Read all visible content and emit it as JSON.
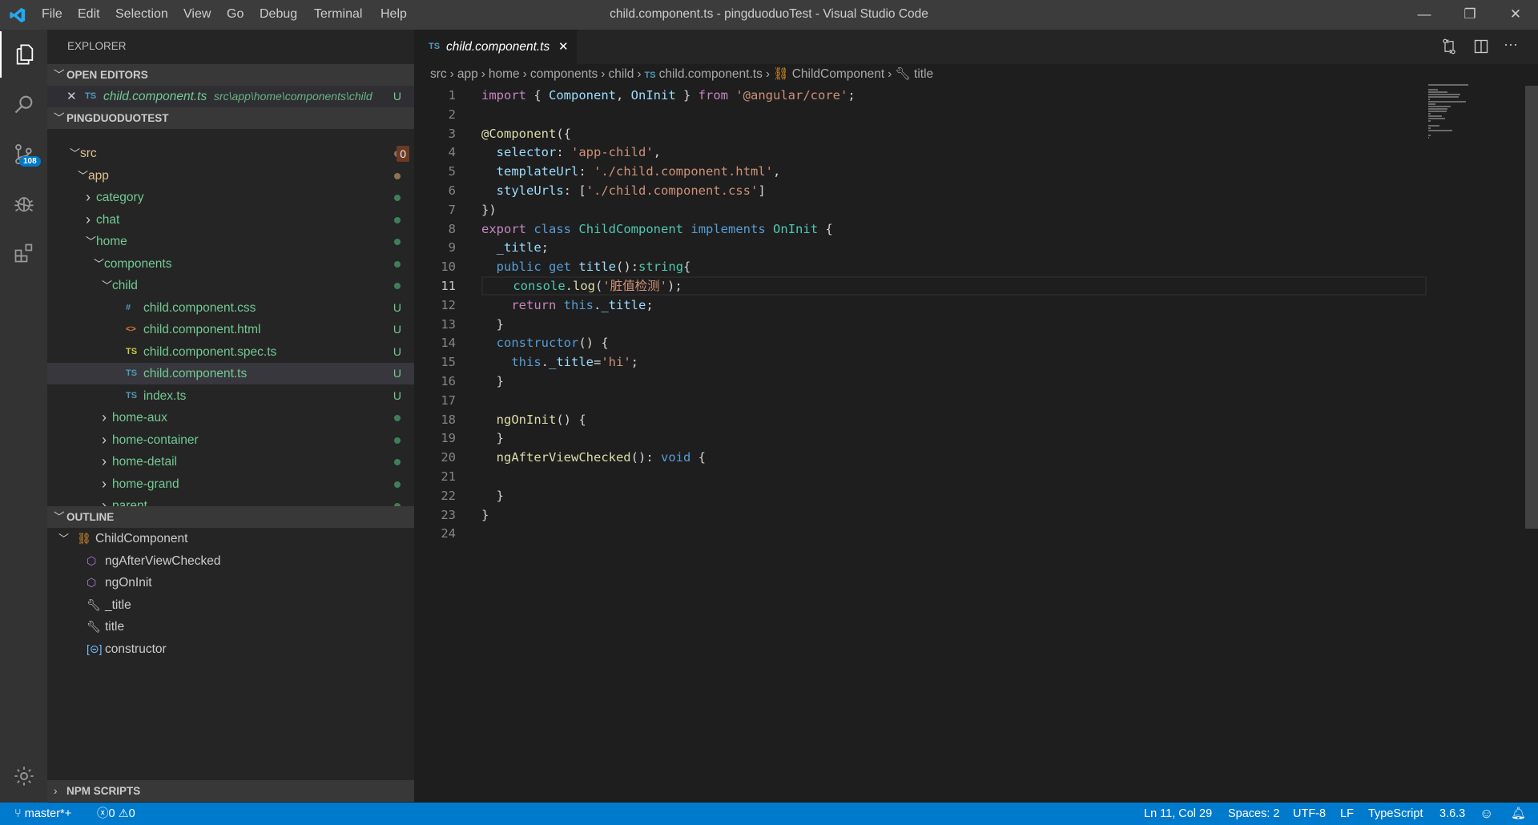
{
  "window": {
    "title": "child.component.ts - pingduoduoTest - Visual Studio Code",
    "menu": [
      "File",
      "Edit",
      "Selection",
      "View",
      "Go",
      "Debug",
      "Terminal",
      "Help"
    ],
    "controls": {
      "minimize": "—",
      "restore": "❐",
      "close": "✕"
    }
  },
  "activity_bar": {
    "items": [
      "explorer-icon",
      "search-icon",
      "source-control-icon",
      "debug-icon",
      "extensions-icon"
    ],
    "scm_badge": "108",
    "settings": "gear-icon"
  },
  "sidebar": {
    "title": "EXPLORER",
    "open_editors": {
      "header": "OPEN EDITORS",
      "items": [
        {
          "icon": "TS",
          "name": "child.component.ts",
          "path": "src\\app\\home\\components\\child",
          "status": "U"
        }
      ]
    },
    "project": {
      "header": "PINGDUODUOTEST",
      "tree": [
        {
          "name": "src",
          "depth": 0,
          "kind": "folder",
          "expanded": true,
          "status": "badge",
          "badge": "0",
          "color": "#e2c08d"
        },
        {
          "name": "app",
          "depth": 1,
          "kind": "folder",
          "expanded": true,
          "status": "dot",
          "color": "#e2c08d",
          "dot": "#8a7356"
        },
        {
          "name": "category",
          "depth": 2,
          "kind": "folder",
          "expanded": false,
          "status": "dot",
          "color": "#73c991"
        },
        {
          "name": "chat",
          "depth": 2,
          "kind": "folder",
          "expanded": false,
          "status": "dot",
          "color": "#73c991"
        },
        {
          "name": "home",
          "depth": 2,
          "kind": "folder",
          "expanded": true,
          "status": "dot",
          "color": "#73c991"
        },
        {
          "name": "components",
          "depth": 3,
          "kind": "folder",
          "expanded": true,
          "status": "dot",
          "color": "#73c991"
        },
        {
          "name": "child",
          "depth": 4,
          "kind": "folder",
          "expanded": true,
          "status": "dot",
          "color": "#73c991"
        },
        {
          "name": "child.component.css",
          "depth": 5,
          "kind": "file",
          "icon": "#",
          "iconColor": "#519aba",
          "status": "U",
          "color": "#73c991"
        },
        {
          "name": "child.component.html",
          "depth": 5,
          "kind": "file",
          "icon": "<>",
          "iconColor": "#e37933",
          "status": "U",
          "color": "#73c991"
        },
        {
          "name": "child.component.spec.ts",
          "depth": 5,
          "kind": "file",
          "icon": "TS",
          "iconColor": "#cbcb41",
          "status": "U",
          "color": "#73c991"
        },
        {
          "name": "child.component.ts",
          "depth": 5,
          "kind": "file",
          "icon": "TS",
          "iconColor": "#519aba",
          "status": "U",
          "color": "#73c991",
          "selected": true
        },
        {
          "name": "index.ts",
          "depth": 5,
          "kind": "file",
          "icon": "TS",
          "iconColor": "#519aba",
          "status": "U",
          "color": "#73c991"
        },
        {
          "name": "home-aux",
          "depth": 4,
          "kind": "folder",
          "expanded": false,
          "status": "dot",
          "color": "#73c991"
        },
        {
          "name": "home-container",
          "depth": 4,
          "kind": "folder",
          "expanded": false,
          "status": "dot",
          "color": "#73c991"
        },
        {
          "name": "home-detail",
          "depth": 4,
          "kind": "folder",
          "expanded": false,
          "status": "dot",
          "color": "#73c991"
        },
        {
          "name": "home-grand",
          "depth": 4,
          "kind": "folder",
          "expanded": false,
          "status": "dot",
          "color": "#73c991"
        },
        {
          "name": "parent",
          "depth": 4,
          "kind": "folder",
          "expanded": false,
          "status": "dot",
          "color": "#73c991"
        }
      ]
    },
    "outline": {
      "header": "OUTLINE",
      "items": [
        {
          "name": "ChildComponent",
          "depth": 0,
          "icon": "class-icon",
          "expanded": true
        },
        {
          "name": "ngAfterViewChecked",
          "depth": 1,
          "icon": "method-icon"
        },
        {
          "name": "ngOnInit",
          "depth": 1,
          "icon": "method-icon"
        },
        {
          "name": "_title",
          "depth": 1,
          "icon": "property-icon"
        },
        {
          "name": "title",
          "depth": 1,
          "icon": "property-icon"
        },
        {
          "name": "constructor",
          "depth": 1,
          "icon": "constructor-icon"
        }
      ]
    },
    "npm_scripts": {
      "header": "NPM SCRIPTS"
    }
  },
  "editor": {
    "tab": {
      "icon": "TS",
      "label": "child.component.ts",
      "close": "✕"
    },
    "breadcrumbs": [
      "src",
      "app",
      "home",
      "components",
      "child",
      "child.component.ts",
      "ChildComponent",
      "title"
    ],
    "current_line": 11,
    "lines": [
      [
        [
          "import",
          "kw"
        ],
        [
          " { ",
          "pl"
        ],
        [
          "Component",
          "va"
        ],
        [
          ", ",
          "pl"
        ],
        [
          "OnInit",
          "va"
        ],
        [
          " } ",
          "pl"
        ],
        [
          "from",
          "kw"
        ],
        [
          " ",
          "pl"
        ],
        [
          "'@angular/core'",
          "st"
        ],
        [
          ";",
          "pl"
        ]
      ],
      [],
      [
        [
          "@Component",
          "dec"
        ],
        [
          "({",
          "pl"
        ]
      ],
      [
        [
          "  ",
          "pl"
        ],
        [
          "selector",
          "va"
        ],
        [
          ": ",
          "pl"
        ],
        [
          "'app-child'",
          "st"
        ],
        [
          ",",
          "pl"
        ]
      ],
      [
        [
          "  ",
          "pl"
        ],
        [
          "templateUrl",
          "va"
        ],
        [
          ": ",
          "pl"
        ],
        [
          "'./child.component.html'",
          "st"
        ],
        [
          ",",
          "pl"
        ]
      ],
      [
        [
          "  ",
          "pl"
        ],
        [
          "styleUrls",
          "va"
        ],
        [
          ": [",
          "pl"
        ],
        [
          "'./child.component.css'",
          "st"
        ],
        [
          "]",
          "pl"
        ]
      ],
      [
        [
          "})",
          "pl"
        ]
      ],
      [
        [
          "export",
          "kw"
        ],
        [
          " ",
          "pl"
        ],
        [
          "class",
          "sk"
        ],
        [
          " ",
          "pl"
        ],
        [
          "ChildComponent",
          "ty"
        ],
        [
          " ",
          "pl"
        ],
        [
          "implements",
          "sk"
        ],
        [
          " ",
          "pl"
        ],
        [
          "OnInit",
          "ty"
        ],
        [
          " {",
          "pl"
        ]
      ],
      [
        [
          "  ",
          "pl"
        ],
        [
          "_title",
          "va"
        ],
        [
          ";",
          "pl"
        ]
      ],
      [
        [
          "  ",
          "pl"
        ],
        [
          "public",
          "sk"
        ],
        [
          " ",
          "pl"
        ],
        [
          "get",
          "sk"
        ],
        [
          " ",
          "pl"
        ],
        [
          "title",
          "va"
        ],
        [
          "():",
          "pl"
        ],
        [
          "string",
          "ty"
        ],
        [
          "{",
          "pl"
        ]
      ],
      [
        [
          "    ",
          "pl"
        ],
        [
          "console",
          "ty"
        ],
        [
          ".",
          "pl"
        ],
        [
          "log",
          "fn"
        ],
        [
          "(",
          "pl"
        ],
        [
          "'脏值检测'",
          "st"
        ],
        [
          ");",
          "pl"
        ]
      ],
      [
        [
          "    ",
          "pl"
        ],
        [
          "return",
          "kw"
        ],
        [
          " ",
          "pl"
        ],
        [
          "this",
          "sk"
        ],
        [
          ".",
          "pl"
        ],
        [
          "_title",
          "va"
        ],
        [
          ";",
          "pl"
        ]
      ],
      [
        [
          "  }",
          "pl"
        ]
      ],
      [
        [
          "  ",
          "pl"
        ],
        [
          "constructor",
          "sk"
        ],
        [
          "() {",
          "pl"
        ]
      ],
      [
        [
          "    ",
          "pl"
        ],
        [
          "this",
          "sk"
        ],
        [
          ".",
          "pl"
        ],
        [
          "_title",
          "va"
        ],
        [
          "=",
          "pl"
        ],
        [
          "'hi'",
          "st"
        ],
        [
          ";",
          "pl"
        ]
      ],
      [
        [
          "  }",
          "pl"
        ]
      ],
      [],
      [
        [
          "  ",
          "pl"
        ],
        [
          "ngOnInit",
          "fn"
        ],
        [
          "() {",
          "pl"
        ]
      ],
      [
        [
          "  }",
          "pl"
        ]
      ],
      [
        [
          "  ",
          "pl"
        ],
        [
          "ngAfterViewChecked",
          "fn"
        ],
        [
          "(): ",
          "pl"
        ],
        [
          "void",
          "sk"
        ],
        [
          " {",
          "pl"
        ]
      ],
      [],
      [
        [
          "  }",
          "pl"
        ]
      ],
      [
        [
          "}",
          "pl"
        ]
      ],
      []
    ]
  },
  "status_bar": {
    "branch": "master*+",
    "errors": "0",
    "warnings": "0",
    "position": "Ln 11, Col 29",
    "spaces": "Spaces: 2",
    "encoding": "UTF-8",
    "eol": "LF",
    "language": "TypeScript",
    "ts_version": "3.6.3"
  },
  "colors": {
    "accent": "#007acc",
    "git_untracked": "#73c991",
    "git_modified": "#e2c08d"
  }
}
